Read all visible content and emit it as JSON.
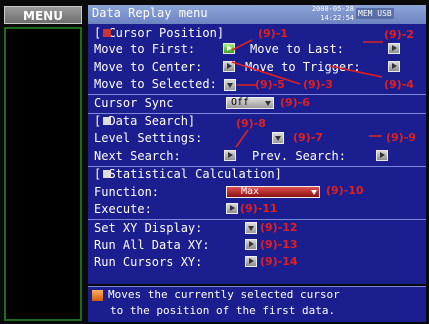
{
  "menu_label": "MENU",
  "title": "Data Replay menu",
  "datetime": [
    "2008-05-28",
    "14:22:54"
  ],
  "usb": "MEM USB",
  "sections": {
    "cursor_position": "[   Cursor Position]",
    "data_search": "[   Data Search]",
    "statistical": "[   Statistical Calculation]"
  },
  "rows": {
    "move_first": "Move to First:",
    "move_last": "Move to Last:",
    "move_center": "Move to Center:",
    "move_trigger": "Move to Trigger:",
    "move_selected": "Move to Selected:",
    "cursor_sync": "Cursor Sync",
    "level_settings": "Level Settings:",
    "next_search": "Next Search:",
    "prev_search": "Prev. Search:",
    "function": "Function:",
    "execute": "Execute:",
    "set_xy": "Set XY Display:",
    "run_all_xy": "Run All Data XY:",
    "run_cursors_xy": "Run Cursors XY:"
  },
  "dropdowns": {
    "cursor_sync": "Off",
    "function": "Max"
  },
  "annotations": {
    "a1": "(9)-1",
    "a2": "(9)-2",
    "a3": "(9)-3",
    "a4": "(9)-4",
    "a5": "(9)-5",
    "a6": "(9)-6",
    "a7": "(9)-7",
    "a8": "(9)-8",
    "a9": "(9)-9",
    "a10": "(9)-10",
    "a11": "(9)-11",
    "a12": "(9)-12",
    "a13": "(9)-13",
    "a14": "(9)-14"
  },
  "help": {
    "line1": "Moves the currently selected cursor",
    "line2": "to the position of the first data."
  },
  "colors": {
    "panel_bg": "#1b1e8e",
    "title_bar": "#7b92cc",
    "annotation": "#e02020",
    "active_button": "#5cc23a"
  }
}
